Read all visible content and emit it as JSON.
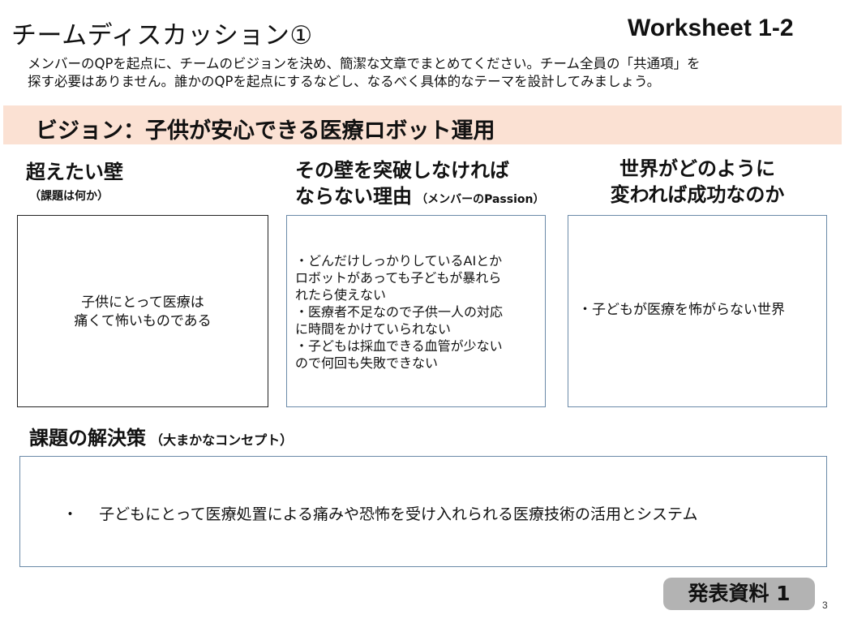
{
  "header": {
    "title": "チームディスカッション①",
    "worksheet_label": "Worksheet 1-2"
  },
  "instructions": {
    "line1": "メンバーのQPを起点に、チームのビジョンを決め、簡潔な文章でまとめてください。チーム全員の「共通項」を",
    "line2": "探す必要はありません。誰かのQPを起点にするなどし、なるべく具体的なテーマを設計してみましょう。"
  },
  "vision": {
    "text": "ビジョン：子供が安心できる医療ロボット運用"
  },
  "columns": {
    "wall": {
      "heading": "超えたい壁",
      "note": "（課題は何か）",
      "content_lines": [
        "子供にとって医療は",
        "痛くて怖いものである"
      ]
    },
    "reason": {
      "heading_line1": "その壁を突破しなければ",
      "heading_line2": "ならない理由",
      "note": "（メンバーのPassion）",
      "content_lines": [
        "・どんだけしっかりしているAIとか",
        "ロボットがあっても子どもが暴れら",
        "れたら使えない",
        "・医療者不足なので子供一人の対応",
        "に時間をかけていられない",
        "・子どもは採血できる血管が少ない",
        "ので何回も失敗できない"
      ]
    },
    "success": {
      "heading_line1": "世界がどのように",
      "heading_line2": "変われば成功なのか",
      "content": "・子どもが医療を怖がらない世界"
    }
  },
  "solution": {
    "heading": "課題の解決策",
    "note": "（大まかなコンセプト）",
    "bullet": "・",
    "content": "子どもにとって医療処置による痛みや恐怖を受け入れられる医療技術の活用とシステム"
  },
  "footer": {
    "badge": "発表資料 1",
    "page_number": "3"
  }
}
